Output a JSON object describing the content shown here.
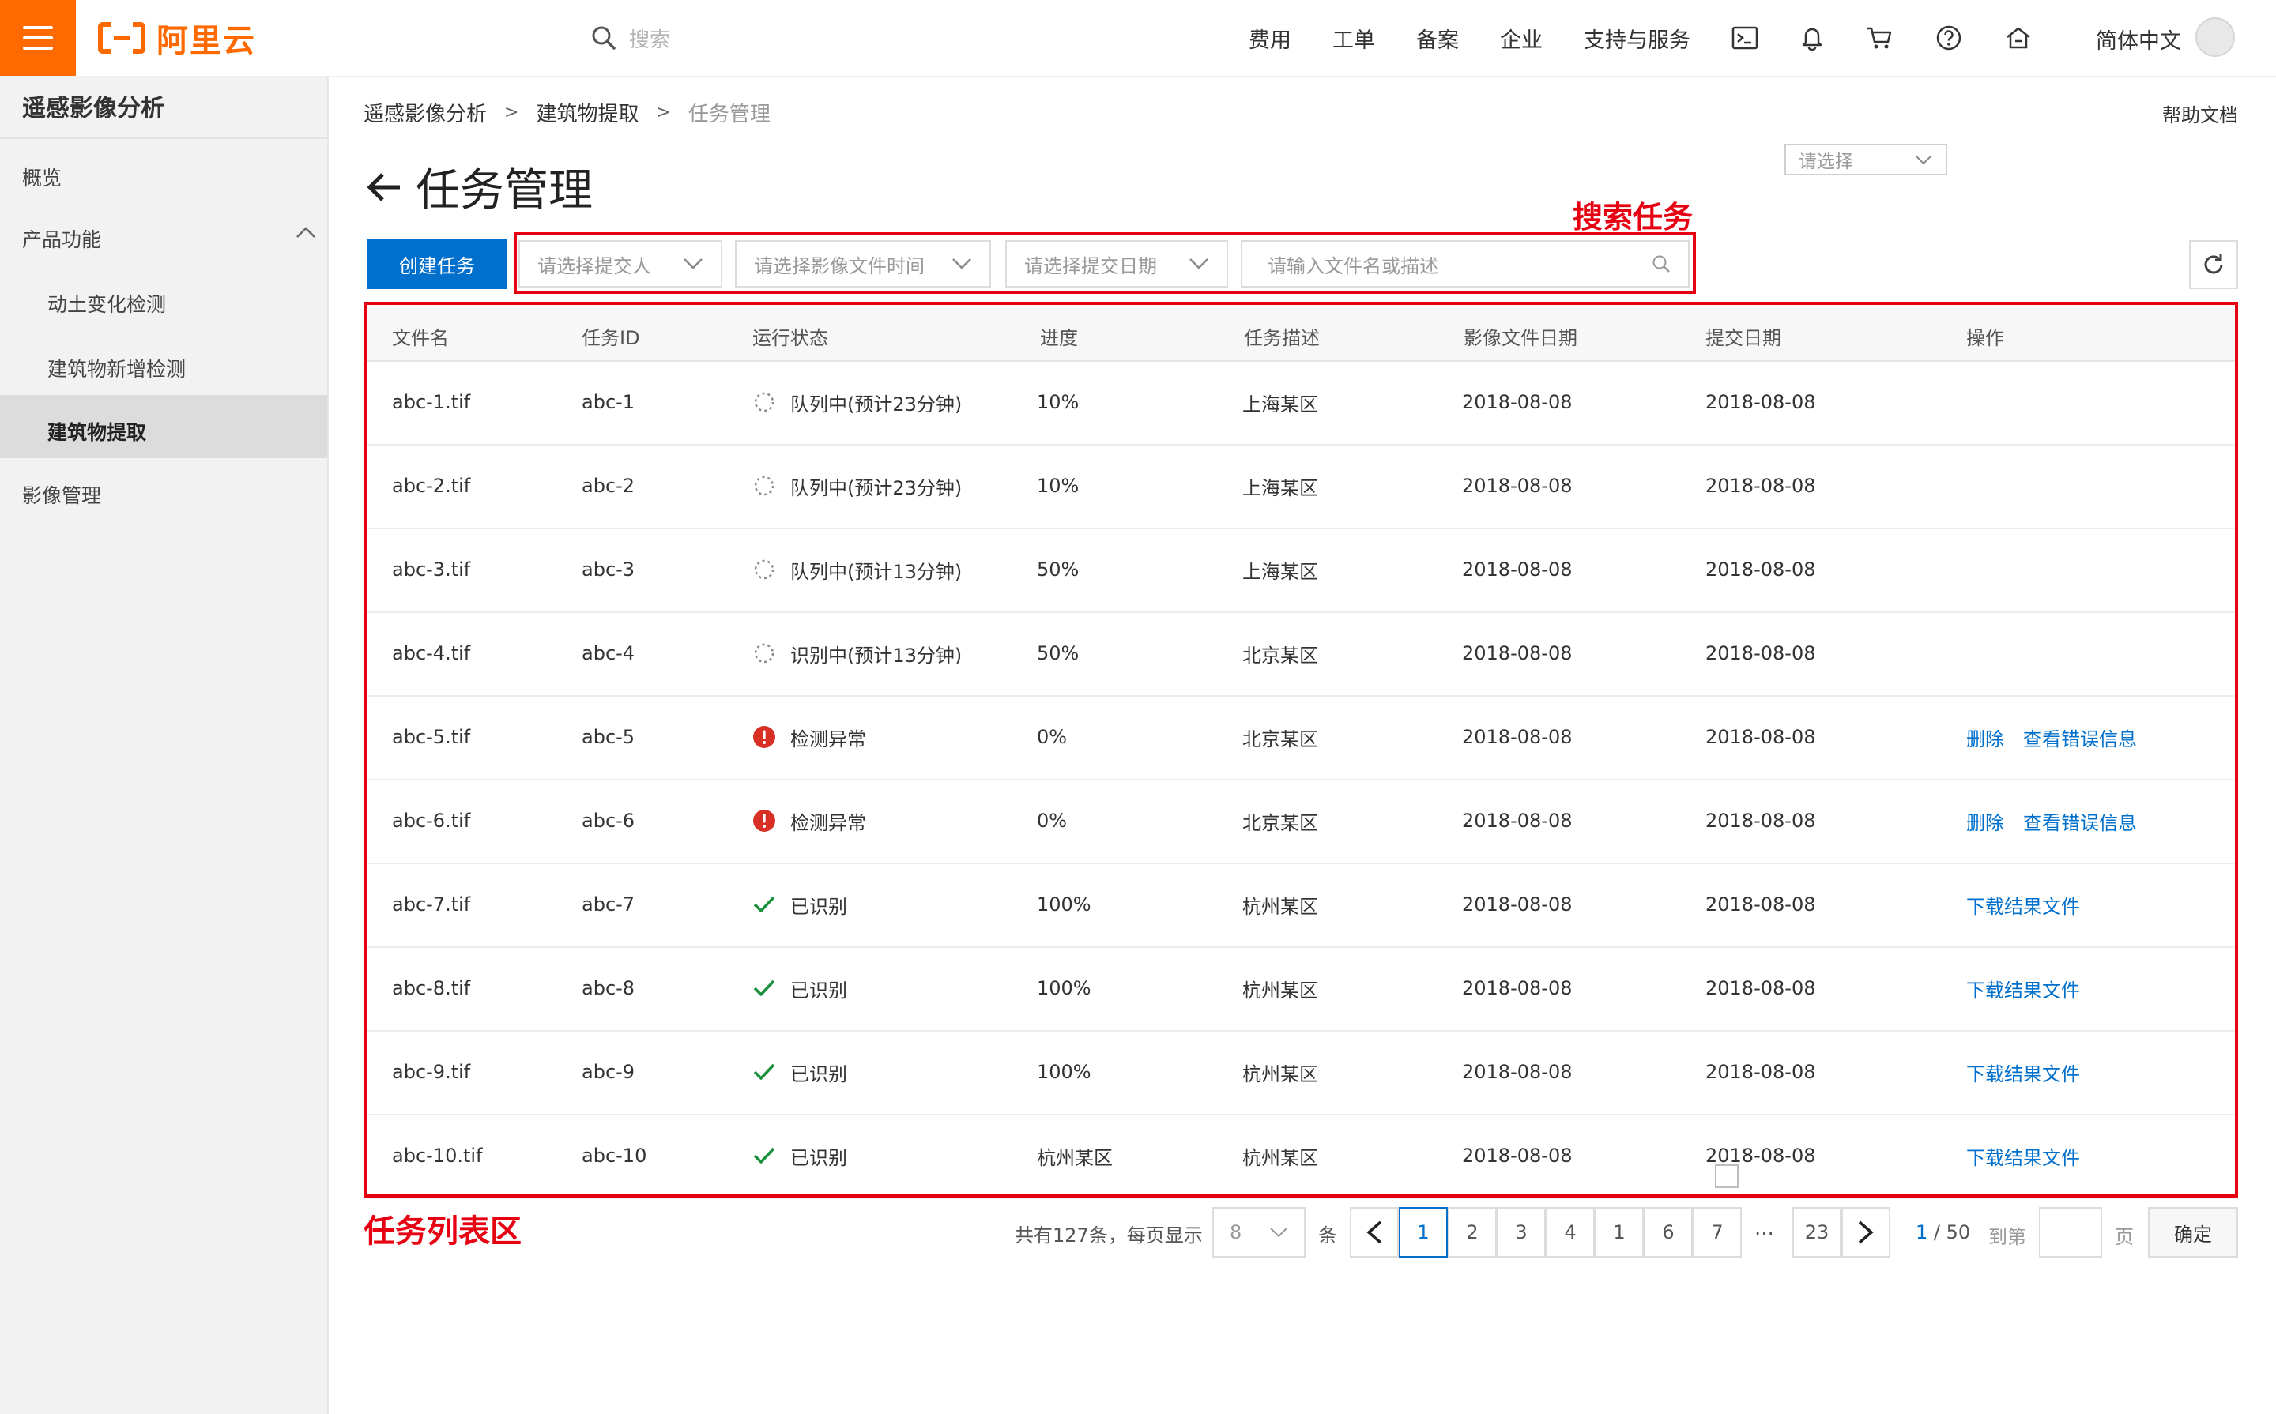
{
  "header": {
    "logo_text": "阿里云",
    "search_placeholder": "搜索",
    "nav": [
      "费用",
      "工单",
      "备案",
      "企业",
      "支持与服务"
    ],
    "icons": [
      "terminal-icon",
      "bell-icon",
      "cart-icon",
      "help-icon",
      "home-icon"
    ],
    "language": "简体中文"
  },
  "sidebar": {
    "title": "遥感影像分析",
    "overview": "概览",
    "product": "产品功能",
    "sub_items": [
      "动土变化检测",
      "建筑物新增检测",
      "建筑物提取"
    ],
    "active": "建筑物提取",
    "image_mgmt": "影像管理"
  },
  "breadcrumb": [
    "遥感影像分析",
    "建筑物提取",
    "任务管理"
  ],
  "help_doc": "帮助文档",
  "page_title": "任务管理",
  "top_select": "请选择",
  "toolbar": {
    "create": "创建任务",
    "submitter": "请选择提交人",
    "file_time": "请选择影像文件时间",
    "submit_date": "请选择提交日期",
    "search_placeholder": "请输入文件名或描述"
  },
  "annotations": {
    "search": "搜索任务",
    "table": "任务列表区"
  },
  "table": {
    "columns": [
      "文件名",
      "任务ID",
      "运行状态",
      "进度",
      "任务描述",
      "影像文件日期",
      "提交日期",
      "操作"
    ],
    "rows": [
      {
        "file": "abc-1.tif",
        "id": "abc-1",
        "status": "队列中(预计23分钟)",
        "icon": "spinner-icon",
        "progress": "10%",
        "desc": "上海某区",
        "img_date": "2018-08-08",
        "sub_date": "2018-08-08",
        "actions": []
      },
      {
        "file": "abc-2.tif",
        "id": "abc-2",
        "status": "队列中(预计23分钟)",
        "icon": "spinner-icon",
        "progress": "10%",
        "desc": "上海某区",
        "img_date": "2018-08-08",
        "sub_date": "2018-08-08",
        "actions": []
      },
      {
        "file": "abc-3.tif",
        "id": "abc-3",
        "status": "队列中(预计13分钟)",
        "icon": "spinner-icon",
        "progress": "50%",
        "desc": "上海某区",
        "img_date": "2018-08-08",
        "sub_date": "2018-08-08",
        "actions": []
      },
      {
        "file": "abc-4.tif",
        "id": "abc-4",
        "status": "识别中(预计13分钟)",
        "icon": "spinner-icon",
        "progress": "50%",
        "desc": "北京某区",
        "img_date": "2018-08-08",
        "sub_date": "2018-08-08",
        "actions": []
      },
      {
        "file": "abc-5.tif",
        "id": "abc-5",
        "status": "检测异常",
        "icon": "error-icon",
        "progress": "0%",
        "desc": "北京某区",
        "img_date": "2018-08-08",
        "sub_date": "2018-08-08",
        "actions": [
          "删除",
          "查看错误信息"
        ]
      },
      {
        "file": "abc-6.tif",
        "id": "abc-6",
        "status": "检测异常",
        "icon": "error-icon",
        "progress": "0%",
        "desc": "北京某区",
        "img_date": "2018-08-08",
        "sub_date": "2018-08-08",
        "actions": [
          "删除",
          "查看错误信息"
        ]
      },
      {
        "file": "abc-7.tif",
        "id": "abc-7",
        "status": "已识别",
        "icon": "check-icon",
        "progress": "100%",
        "desc": "杭州某区",
        "img_date": "2018-08-08",
        "sub_date": "2018-08-08",
        "actions": [
          "下载结果文件"
        ]
      },
      {
        "file": "abc-8.tif",
        "id": "abc-8",
        "status": "已识别",
        "icon": "check-icon",
        "progress": "100%",
        "desc": "杭州某区",
        "img_date": "2018-08-08",
        "sub_date": "2018-08-08",
        "actions": [
          "下载结果文件"
        ]
      },
      {
        "file": "abc-9.tif",
        "id": "abc-9",
        "status": "已识别",
        "icon": "check-icon",
        "progress": "100%",
        "desc": "杭州某区",
        "img_date": "2018-08-08",
        "sub_date": "2018-08-08",
        "actions": [
          "下载结果文件"
        ]
      },
      {
        "file": "abc-10.tif",
        "id": "abc-10",
        "status": "已识别",
        "icon": "check-icon",
        "progress": "杭州某区",
        "desc": "杭州某区",
        "img_date": "2018-08-08",
        "sub_date": "2018-08-08",
        "actions": [
          "下载结果文件"
        ]
      }
    ]
  },
  "pagination": {
    "total": "共有127条，每页显示",
    "page_size": "8",
    "unit": "条",
    "pages": [
      "1",
      "2",
      "3",
      "4",
      "1",
      "6",
      "7"
    ],
    "ellipsis": "...",
    "last": "23",
    "current": "1",
    "of": "/ 50",
    "goto": "到第",
    "page_word": "页",
    "confirm": "确定"
  },
  "colors": {
    "brand": "#ff6a00",
    "primary": "#0070cc",
    "annotation": "#e60012",
    "error": "#d93026",
    "success": "#1a8f3c"
  }
}
